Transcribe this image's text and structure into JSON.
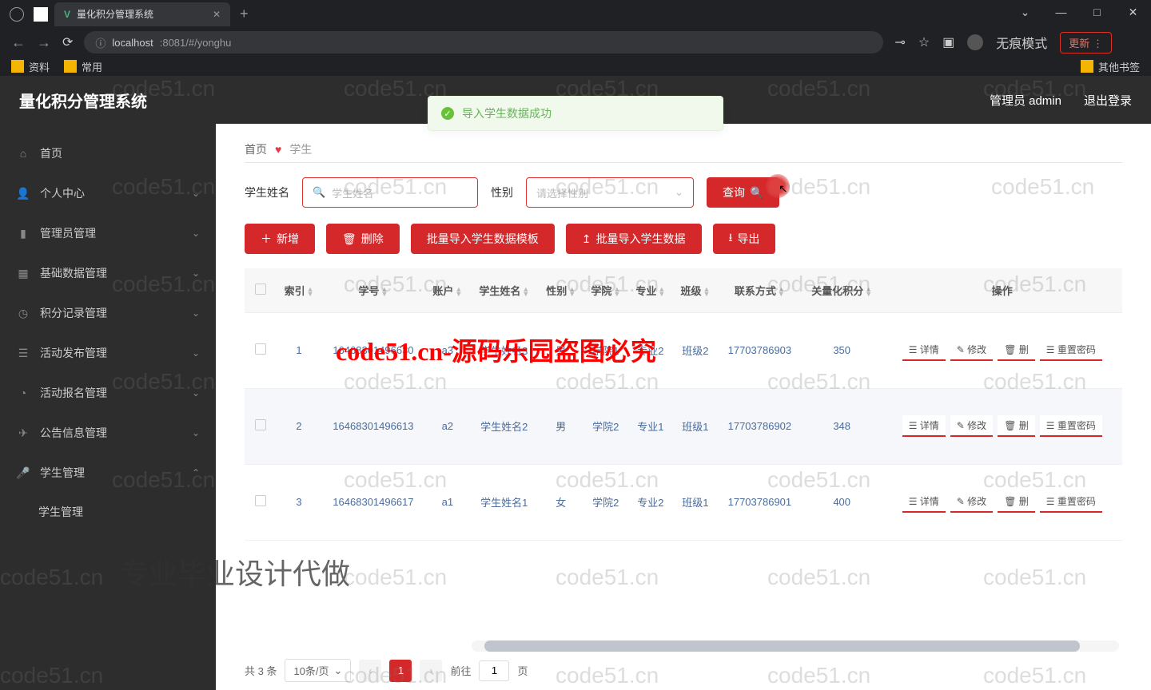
{
  "browser": {
    "tab_title": "量化积分管理系统",
    "url_host": "localhost",
    "url_port_path": ":8081/#/yonghu",
    "incognito_label": "无痕模式",
    "update_label": "更新",
    "bookmarks": [
      "资料",
      "常用"
    ],
    "other_bookmarks": "其他书签"
  },
  "header": {
    "title": "量化积分管理系统",
    "user_label": "管理员 admin",
    "logout_label": "退出登录"
  },
  "sidebar": {
    "items": [
      {
        "icon": "⌂",
        "label": "首页",
        "expandable": false
      },
      {
        "icon": "👤",
        "label": "个人中心",
        "expandable": true
      },
      {
        "icon": "▮",
        "label": "管理员管理",
        "expandable": true
      },
      {
        "icon": "▦",
        "label": "基础数据管理",
        "expandable": true
      },
      {
        "icon": "◷",
        "label": "积分记录管理",
        "expandable": true
      },
      {
        "icon": "☰",
        "label": "活动发布管理",
        "expandable": true
      },
      {
        "icon": "◔",
        "label": "活动报名管理",
        "expandable": true
      },
      {
        "icon": "✈",
        "label": "公告信息管理",
        "expandable": true
      },
      {
        "icon": "🎤",
        "label": "学生管理",
        "expandable": true,
        "expanded": true,
        "sub": [
          "学生管理"
        ]
      }
    ]
  },
  "breadcrumb": {
    "home": "首页",
    "current": "学生"
  },
  "toast": "导入学生数据成功",
  "filters": {
    "name_label": "学生姓名",
    "name_placeholder": "学生姓名",
    "gender_label": "性别",
    "gender_placeholder": "请选择性别",
    "search_btn": "查询"
  },
  "actions": {
    "add": "新增",
    "delete": "删除",
    "template": "批量导入学生数据模板",
    "import": "批量导入学生数据",
    "export": "导出"
  },
  "table": {
    "cols": [
      "索引",
      "学号",
      "账户",
      "学生姓名",
      "性别",
      "学院",
      "专业",
      "班级",
      "联系方式",
      "关量化积分",
      "操作"
    ],
    "rows": [
      {
        "idx": "1",
        "sid": "16468301496630",
        "acct": "a3",
        "name": "学生姓名3",
        "sex": "男",
        "col": "学院1",
        "maj": "专业2",
        "cls": "班级2",
        "tel": "17703786903",
        "score": "350"
      },
      {
        "idx": "2",
        "sid": "16468301496613",
        "acct": "a2",
        "name": "学生姓名2",
        "sex": "男",
        "col": "学院2",
        "maj": "专业1",
        "cls": "班级1",
        "tel": "17703786902",
        "score": "348"
      },
      {
        "idx": "3",
        "sid": "16468301496617",
        "acct": "a1",
        "name": "学生姓名1",
        "sex": "女",
        "col": "学院2",
        "maj": "专业2",
        "cls": "班级1",
        "tel": "17703786901",
        "score": "400"
      }
    ],
    "op_detail": "详情",
    "op_edit": "修改",
    "op_delete": "删",
    "op_reset": "重置密码"
  },
  "pagination": {
    "total": "共 3 条",
    "page_size": "10条/页",
    "current": "1",
    "jump_prefix": "前往",
    "jump_value": "1",
    "jump_suffix": "页"
  },
  "watermark_text": "code51.cn",
  "red_notice": "code51.cn-源码乐园盗图必究",
  "bottom_notice": "专业毕业设计代做"
}
